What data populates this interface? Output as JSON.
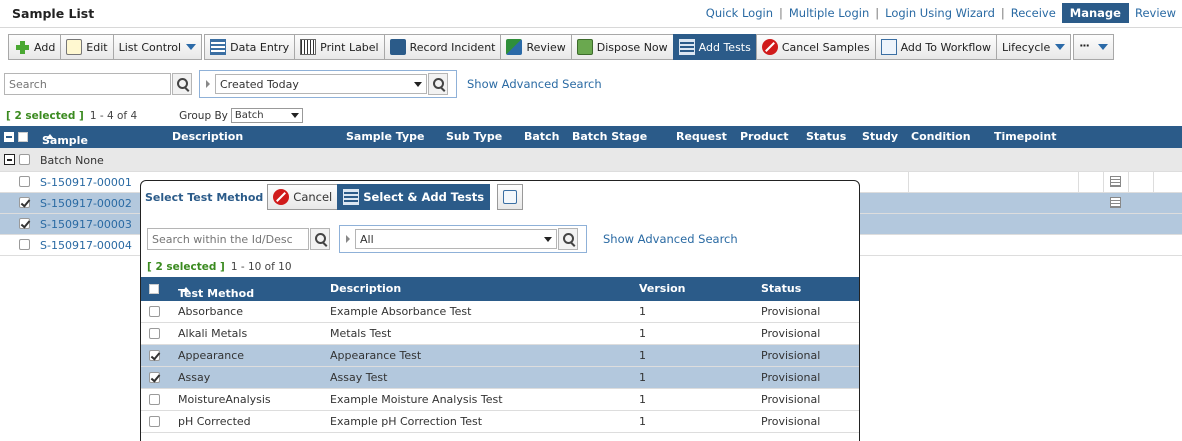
{
  "page": {
    "title": "Sample List",
    "nav": {
      "quick_login": "Quick Login",
      "multiple_login": "Multiple Login",
      "login_wizard": "Login Using Wizard",
      "receive": "Receive",
      "manage": "Manage",
      "review": "Review",
      "separator": "|"
    }
  },
  "toolbar": {
    "add": "Add",
    "edit": "Edit",
    "list_control": "List Control",
    "data_entry": "Data Entry",
    "print_label": "Print Label",
    "record_incident": "Record Incident",
    "review": "Review",
    "dispose_now": "Dispose Now",
    "add_tests": "Add Tests",
    "cancel_samples": "Cancel Samples",
    "add_to_workflow": "Add To Workflow",
    "lifecycle": "Lifecycle",
    "more": "···"
  },
  "search": {
    "placeholder": "Search",
    "filter_value": "Created Today",
    "advanced": "Show Advanced Search"
  },
  "selection": {
    "count": "[ 2 selected ]",
    "range": "1 - 4 of 4",
    "group_by_label": "Group By",
    "group_by_value": "Batch"
  },
  "table": {
    "columns": {
      "sample": "Sample",
      "description": "Description",
      "sample_type": "Sample Type",
      "sub_type": "Sub Type",
      "batch": "Batch",
      "batch_stage": "Batch Stage",
      "request": "Request",
      "product": "Product",
      "status": "Status",
      "study": "Study",
      "condition": "Condition",
      "timepoint": "Timepoint"
    },
    "group_label": "Batch None",
    "rows": [
      {
        "id": "S-150917-00001",
        "selected": false
      },
      {
        "id": "S-150917-00002",
        "selected": true
      },
      {
        "id": "S-150917-00003",
        "selected": true
      },
      {
        "id": "S-150917-00004",
        "selected": false
      }
    ]
  },
  "dialog": {
    "title": "Select Test Method",
    "cancel": "Cancel",
    "select_add": "Select & Add Tests",
    "search_placeholder": "Search within the Id/Desc",
    "filter_value": "All",
    "advanced": "Show Advanced Search",
    "selection_count": "[ 2 selected ]",
    "range": "1 - 10 of 10",
    "columns": {
      "method": "Test Method",
      "description": "Description",
      "version": "Version",
      "status": "Status"
    },
    "rows": [
      {
        "method": "Absorbance",
        "description": "Example Absorbance Test",
        "version": "1",
        "status": "Provisional",
        "selected": false
      },
      {
        "method": "Alkali Metals",
        "description": "Metals Test",
        "version": "1",
        "status": "Provisional",
        "selected": false
      },
      {
        "method": "Appearance",
        "description": "Appearance Test",
        "version": "1",
        "status": "Provisional",
        "selected": true
      },
      {
        "method": "Assay",
        "description": "Assay Test",
        "version": "1",
        "status": "Provisional",
        "selected": true
      },
      {
        "method": "MoistureAnalysis",
        "description": "Example Moisture Analysis Test",
        "version": "1",
        "status": "Provisional",
        "selected": false
      },
      {
        "method": "pH Corrected",
        "description": "Example pH Correction Test",
        "version": "1",
        "status": "Provisional",
        "selected": false
      }
    ]
  }
}
